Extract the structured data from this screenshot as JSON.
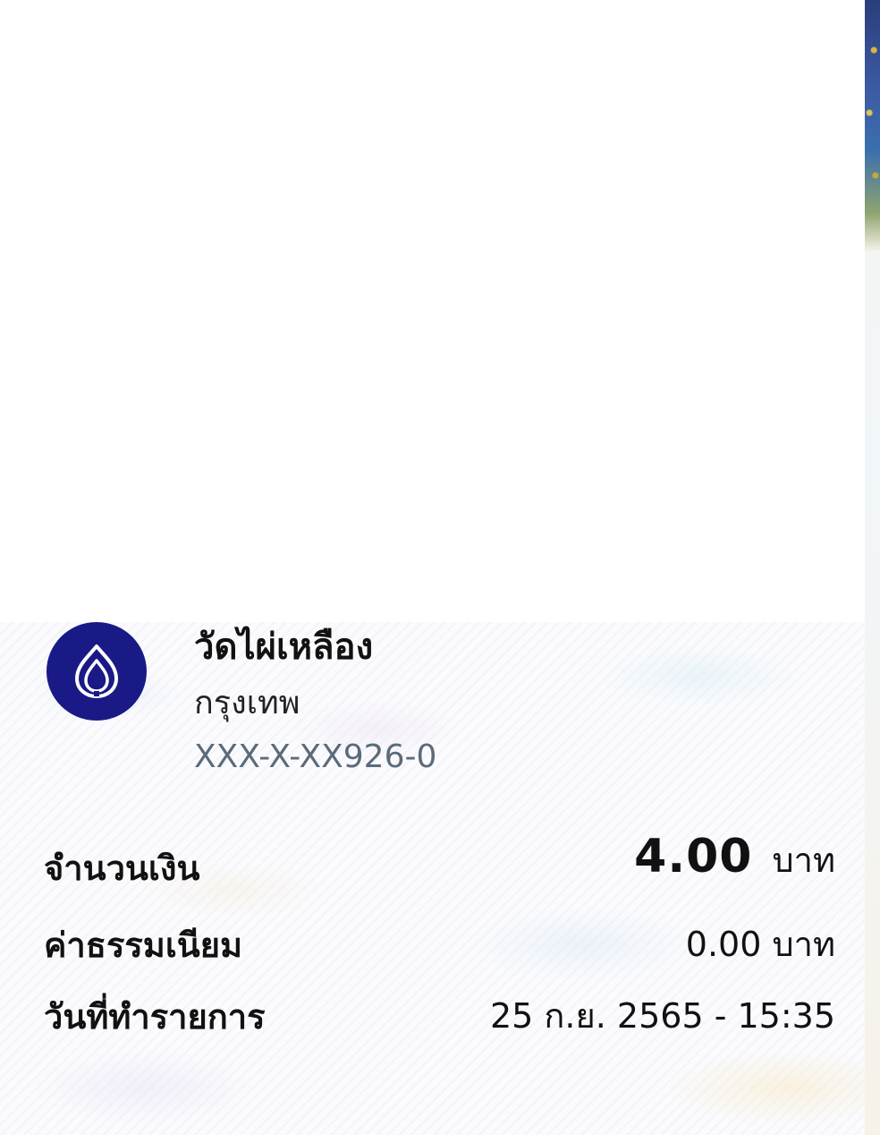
{
  "recipient": {
    "name": "วัดไผ่เหลือง",
    "bank": "กรุงเทพ",
    "account": "XXX-X-XX926-0",
    "logo_icon": "bangkok-bank-lotus-icon",
    "logo_color": "#1a1a86"
  },
  "details": {
    "amount_label": "จำนวนเงิน",
    "amount_value": "4.00",
    "amount_unit": "บาท",
    "fee_label": "ค่าธรรมเนียม",
    "fee_value": "0.00 บาท",
    "date_label": "วันที่ทำรายการ",
    "date_value": "25 ก.ย. 2565 - 15:35"
  }
}
